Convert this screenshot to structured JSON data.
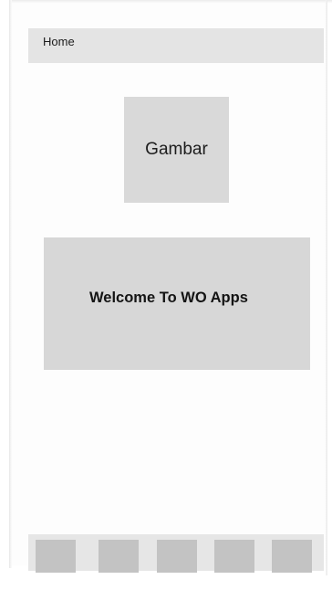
{
  "header": {
    "title": "Home"
  },
  "main": {
    "image_placeholder_label": "Gambar",
    "welcome_text": "Welcome To WO Apps"
  },
  "bottom_nav": {
    "items": [
      {
        "name": "nav-item-1"
      },
      {
        "name": "nav-item-2"
      },
      {
        "name": "nav-item-3"
      },
      {
        "name": "nav-item-4"
      },
      {
        "name": "nav-item-5"
      }
    ]
  },
  "colors": {
    "placeholder_gray": "#d9d9d9",
    "nav_item_gray": "#c3c3c3",
    "header_gray": "#e4e4e4"
  }
}
